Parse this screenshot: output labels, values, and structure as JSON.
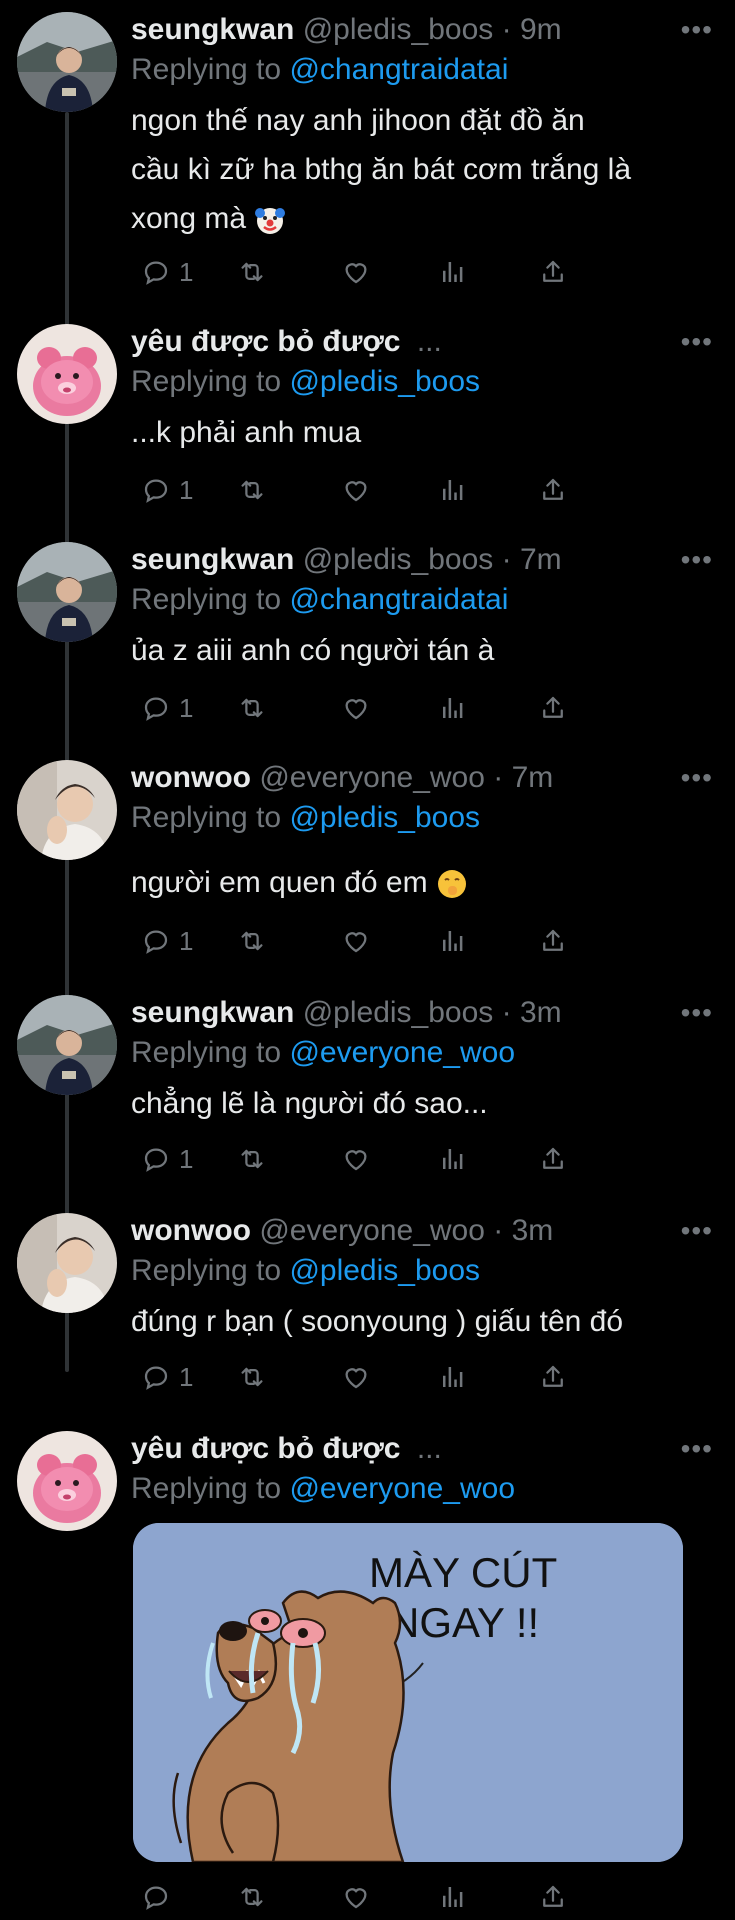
{
  "tweets": [
    {
      "name": "seungkwan",
      "handle": "@pledis_boos",
      "time": "9m",
      "replying_label": "Replying to",
      "replying_to": "@changtraidatai",
      "lines": [
        "ngon thế nay anh jihoon đặt đồ ăn",
        "cầu kì zữ ha bthg ăn bát cơm trắng là",
        "xong mà"
      ],
      "emoji": "clown",
      "reply_count": "1"
    },
    {
      "name": "yêu được bỏ được",
      "handle": "...",
      "time": "",
      "replying_label": "Replying to",
      "replying_to": "@pledis_boos",
      "lines": [
        "...k phải anh mua"
      ],
      "reply_count": "1"
    },
    {
      "name": "seungkwan",
      "handle": "@pledis_boos",
      "time": "7m",
      "replying_label": "Replying to",
      "replying_to": "@changtraidatai",
      "lines": [
        "ủa z aiii anh có người tán à"
      ],
      "reply_count": "1"
    },
    {
      "name": "wonwoo",
      "handle": "@everyone_woo",
      "time": "7m",
      "replying_label": "Replying to",
      "replying_to": "@pledis_boos",
      "lines": [
        "người em quen đó em"
      ],
      "emoji": "shushing",
      "reply_count": "1"
    },
    {
      "name": "seungkwan",
      "handle": "@pledis_boos",
      "time": "3m",
      "replying_label": "Replying to",
      "replying_to": "@everyone_woo",
      "lines": [
        "chẳng lẽ là người đó sao..."
      ],
      "reply_count": "1"
    },
    {
      "name": "wonwoo",
      "handle": "@everyone_woo",
      "time": "3m",
      "replying_label": "Replying to",
      "replying_to": "@pledis_boos",
      "lines": [
        "đúng r bạn ( soonyoung ) giấu tên đó"
      ],
      "reply_count": "1"
    },
    {
      "name": "yêu được bỏ được",
      "handle": "...",
      "time": "",
      "replying_label": "Replying to",
      "replying_to": "@everyone_woo",
      "lines": [],
      "reply_count": "",
      "media": true
    }
  ],
  "meme": {
    "line1": "MÀY CÚT",
    "line2": "NGAY !!"
  },
  "more_label": "•••",
  "colors": {
    "background": "#000000",
    "text": "#e7e9ea",
    "muted": "#71767b",
    "link": "#1d9bf0",
    "thread": "#2f3336",
    "meme_bg": "#8da5cf"
  }
}
